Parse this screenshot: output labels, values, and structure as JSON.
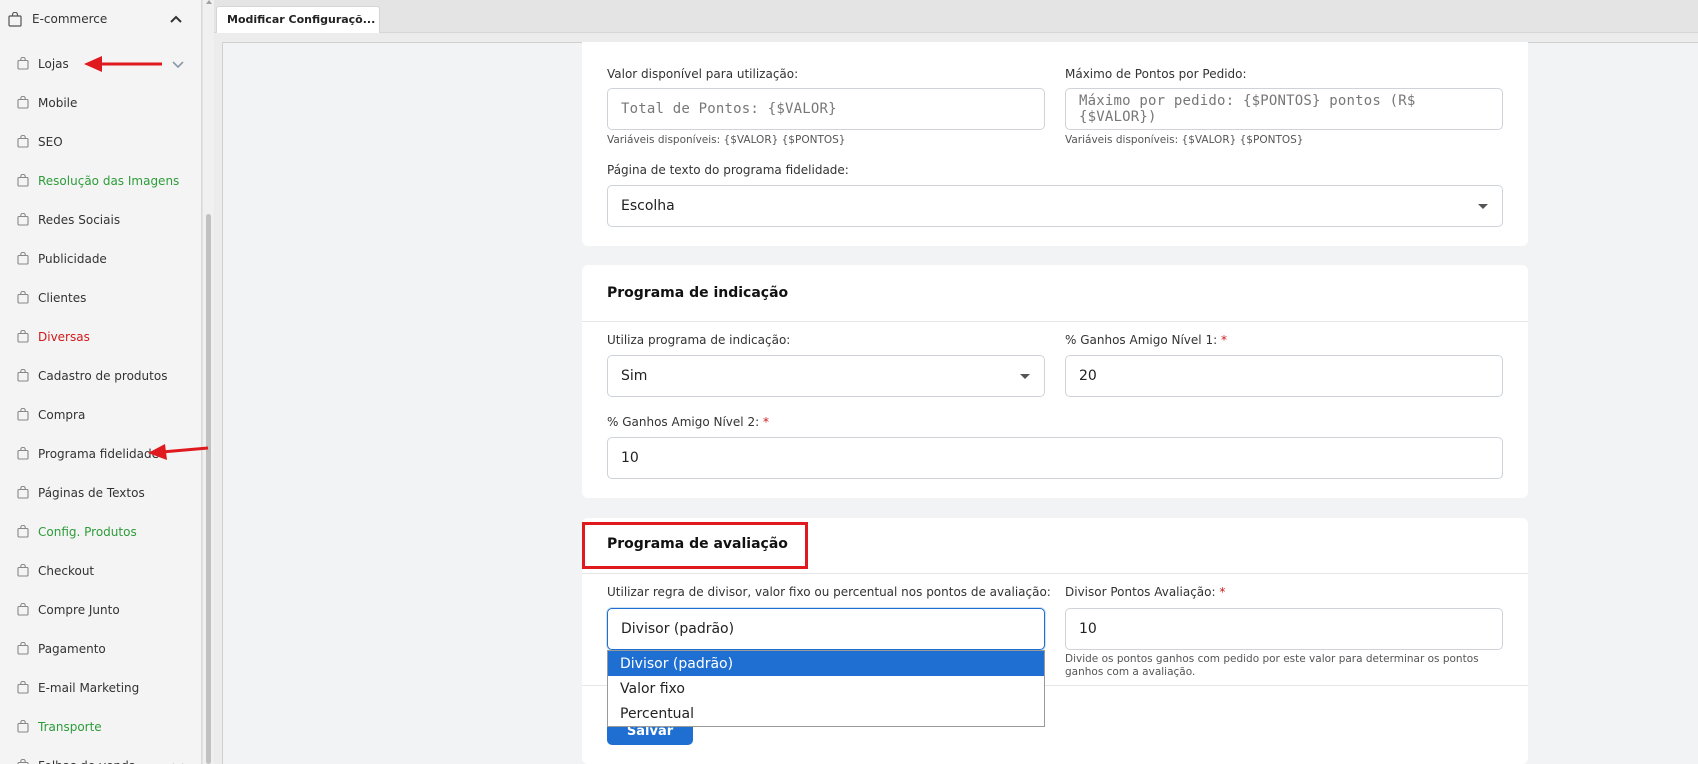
{
  "sidebar": {
    "header": "E-commerce",
    "items": [
      {
        "label": "Lojas",
        "color": "default"
      },
      {
        "label": "Mobile",
        "color": "default"
      },
      {
        "label": "SEO",
        "color": "default"
      },
      {
        "label": "Resolução das Imagens",
        "color": "green"
      },
      {
        "label": "Redes Sociais",
        "color": "default"
      },
      {
        "label": "Publicidade",
        "color": "default"
      },
      {
        "label": "Clientes",
        "color": "default"
      },
      {
        "label": "Diversas",
        "color": "red"
      },
      {
        "label": "Cadastro de produtos",
        "color": "default"
      },
      {
        "label": "Compra",
        "color": "default"
      },
      {
        "label": "Programa fidelidade",
        "color": "default"
      },
      {
        "label": "Páginas de Textos",
        "color": "default"
      },
      {
        "label": "Config. Produtos",
        "color": "green"
      },
      {
        "label": "Checkout",
        "color": "default"
      },
      {
        "label": "Compre Junto",
        "color": "default"
      },
      {
        "label": "Pagamento",
        "color": "default"
      },
      {
        "label": "E-mail Marketing",
        "color": "default"
      },
      {
        "label": "Transporte",
        "color": "green"
      },
      {
        "label": "Folhas de venda",
        "color": "default"
      }
    ]
  },
  "tabs": [
    {
      "label": "Modificar Configuraçõ..."
    }
  ],
  "fidelity_section": {
    "valor_label": "Valor disponível para utilização:",
    "valor_placeholder": "Total de Pontos: {$VALOR}",
    "valor_help": "Variáveis disponíveis: {$VALOR} {$PONTOS}",
    "maximo_label": "Máximo de Pontos por Pedido:",
    "maximo_placeholder": "Máximo por pedido: {$PONTOS} pontos (R$ {$VALOR})",
    "maximo_help": "Variáveis disponíveis: {$VALOR} {$PONTOS}",
    "pagina_label": "Página de texto do programa fidelidade:",
    "pagina_value": "Escolha"
  },
  "indicacao_section": {
    "title": "Programa de indicação",
    "utiliza_label": "Utiliza programa de indicação:",
    "utiliza_value": "Sim",
    "nivel1_label": "% Ganhos Amigo Nível 1:",
    "nivel1_value": "20",
    "nivel2_label": "% Ganhos Amigo Nível 2:",
    "nivel2_value": "10",
    "required_mark": "*"
  },
  "avaliacao_section": {
    "title": "Programa de avaliação",
    "regra_label": "Utilizar regra de divisor, valor fixo ou percentual nos pontos de avaliação:",
    "regra_value": "Divisor (padrão)",
    "regra_options": [
      "Divisor (padrão)",
      "Valor fixo",
      "Percentual"
    ],
    "divisor_label": "Divisor Pontos Avaliação:",
    "divisor_value": "10",
    "divisor_help_1": "Divide os pontos ganhos com pedido por este valor para determinar os pontos",
    "divisor_help_2": "ganhos com a avaliação.",
    "required_mark": "*",
    "save_label": "Salvar"
  },
  "colors": {
    "accent": "#1e6fd1",
    "annotation_red": "#e0191f",
    "green_text": "#2e9c3a",
    "red_text": "#d11a1a"
  }
}
